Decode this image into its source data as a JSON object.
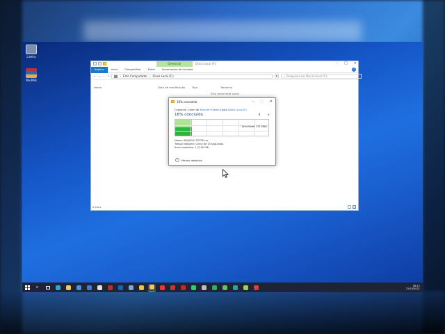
{
  "desktop": {
    "icons": [
      {
        "label": "Lixeira",
        "color": "#7b8fb0"
      },
      {
        "label": "WinRAR",
        "color": "#b5343a"
      }
    ]
  },
  "explorer": {
    "context_tab": "Gerenciar",
    "title_path": "Disco Local (F:)",
    "tabs": [
      "Arquivo",
      "Início",
      "Compartilhar",
      "Exibir",
      "Ferramentas de Unidade"
    ],
    "address": [
      "Este Computador",
      "Disco Local (F:)"
    ],
    "search_placeholder": "Pesquisar em Disco Local (F:)",
    "columns": [
      "Nome",
      "Data de modificação",
      "Tipo",
      "Tamanho"
    ],
    "empty_message": "Esta pasta está vazia.",
    "status": "0 itens"
  },
  "dialog": {
    "title": "18% concluído",
    "copy_prefix": "Copiando 1 item de",
    "copy_source": "Área de Trabalho",
    "copy_mid": "para",
    "copy_dest": "Disco Local (F:)",
    "percent_label": "18% concluído",
    "progress": 0.18,
    "speed": "Velocidade: 251 MB/s",
    "name_line": "Nome: ARQUIVO TESTE.rar",
    "remaining_line": "Tempo restante: Cerca de 15 segundos",
    "items_line": "Itens restantes: 1 (2,90 GB)",
    "less_details": "Menos detalhes"
  },
  "taskbar": {
    "apps": [
      {
        "name": "edge-icon",
        "color": "#2fa3e0"
      },
      {
        "name": "file-explorer-icon",
        "color": "#f2c94c"
      },
      {
        "name": "store-icon",
        "color": "#4a8fe0"
      },
      {
        "name": "mail-icon",
        "color": "#3d7ed8"
      },
      {
        "name": "chrome-icon",
        "color": "#e0e0e0"
      },
      {
        "name": "app-red-icon",
        "color": "#c62828"
      },
      {
        "name": "app-blue-icon",
        "color": "#1565c0"
      },
      {
        "name": "photos-icon",
        "color": "#7aa7e0"
      },
      {
        "name": "app-yellow-icon",
        "color": "#e8c24a"
      },
      {
        "name": "file-explorer-open-icon",
        "color": "#f2c94c"
      },
      {
        "name": "app-red2-icon",
        "color": "#e53935"
      },
      {
        "name": "app-red3-icon",
        "color": "#d32f2f"
      },
      {
        "name": "app-red4-icon",
        "color": "#c62828"
      },
      {
        "name": "whatsapp-icon",
        "color": "#25d366"
      },
      {
        "name": "app-grey-icon",
        "color": "#bdbdbd"
      },
      {
        "name": "spotify-icon",
        "color": "#1db954"
      },
      {
        "name": "app-green-icon",
        "color": "#66bb6a"
      },
      {
        "name": "app-teal-icon",
        "color": "#26a69a"
      },
      {
        "name": "app-lime-icon",
        "color": "#9ccc65"
      },
      {
        "name": "app-red5-icon",
        "color": "#e53935"
      }
    ],
    "time": "08:12",
    "date": "21/10/2021"
  }
}
